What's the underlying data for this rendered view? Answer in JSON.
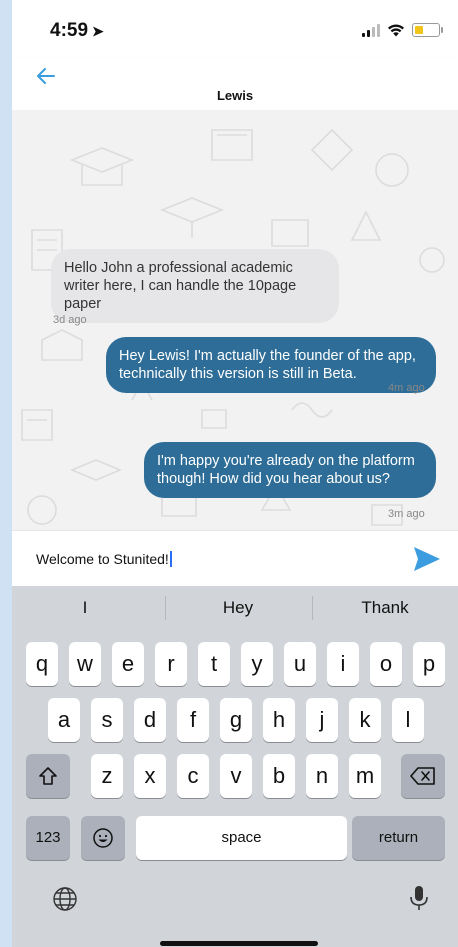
{
  "status_bar": {
    "time": "4:59",
    "location_glyph": "➤"
  },
  "header": {
    "title": "Lewis"
  },
  "messages": [
    {
      "direction": "incoming",
      "text": "Hello John a professional academic writer here, I can handle the 10page paper",
      "time": "3d ago"
    },
    {
      "direction": "outgoing",
      "text": "Hey Lewis! I'm actually the founder of the app, technically this version is still in Beta.",
      "time": "4m ago"
    },
    {
      "direction": "outgoing",
      "text": "I'm happy you're already on the platform though! How did you hear about us?",
      "time": "3m ago"
    }
  ],
  "composer": {
    "value": "Welcome to Stunited!"
  },
  "keyboard": {
    "suggestions": [
      "I",
      "Hey",
      "Thank"
    ],
    "row1": [
      "q",
      "w",
      "e",
      "r",
      "t",
      "y",
      "u",
      "i",
      "o",
      "p"
    ],
    "row2": [
      "a",
      "s",
      "d",
      "f",
      "g",
      "h",
      "j",
      "k",
      "l"
    ],
    "row3": [
      "z",
      "x",
      "c",
      "v",
      "b",
      "n",
      "m"
    ],
    "numbers_key": "123",
    "space_key": "space",
    "return_key": "return"
  },
  "colors": {
    "outgoing_bubble": "#2d6d97",
    "incoming_bubble": "#e6e6e8",
    "accent": "#3b9de0"
  }
}
